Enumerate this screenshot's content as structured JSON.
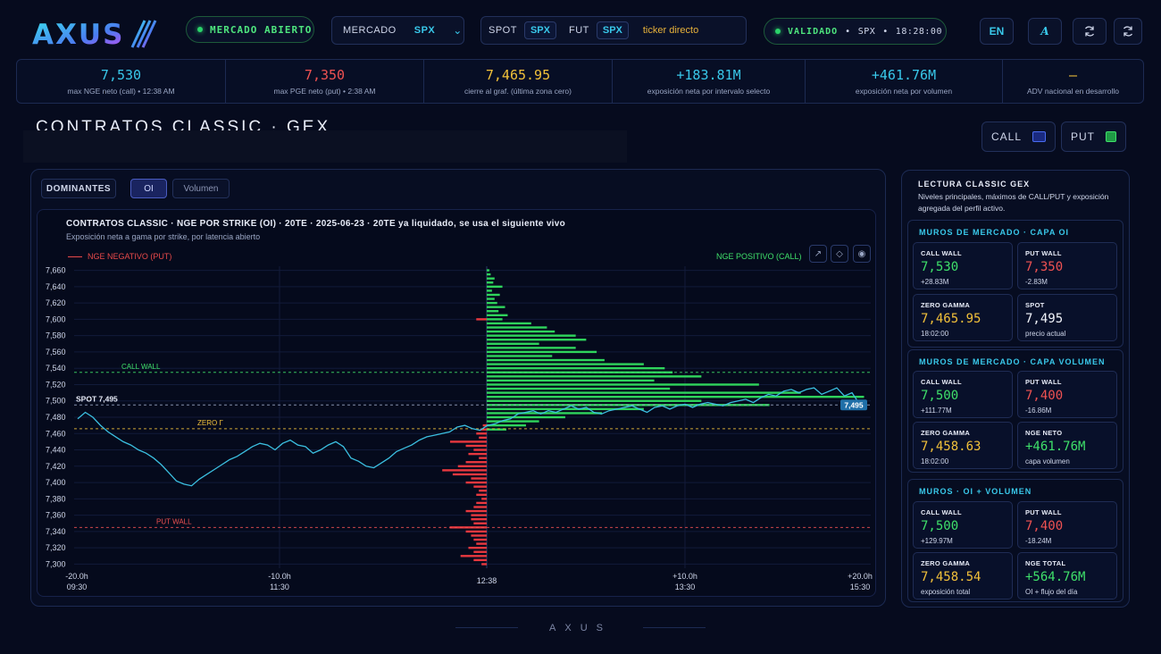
{
  "brand": {
    "logo_text": "AXUS"
  },
  "header": {
    "market_status": "MERCADO ABIERTO",
    "market_label": "MERCADO",
    "market_value": "SPX",
    "spot_label": "SPOT",
    "spot_tag": "SPX",
    "fut_label": "FUT",
    "fut_tag": "SPX",
    "ticker_placeholder": "ticker directo",
    "validated": "VALIDADO",
    "validated_symbol": "SPX",
    "validated_time": "18:28:00",
    "lang": "EN",
    "font_btn": "A"
  },
  "stats": [
    {
      "value": "7,530",
      "label": "max NGE neto (call) • 12:38 AM",
      "color": "#39c8ea"
    },
    {
      "value": "7,350",
      "label": "max PGE neto (put) • 2:38 AM",
      "color": "#f05252"
    },
    {
      "value": "7,465.95",
      "label": "cierre al graf. (última zona cero)",
      "color": "#f2c13a"
    },
    {
      "value": "+183.81M",
      "label": "exposición neta por intervalo selecto",
      "color": "#39c8ea"
    },
    {
      "value": "+461.76M",
      "label": "exposición neta por volumen",
      "color": "#39c8ea"
    },
    {
      "value": "—",
      "label": "ADV nacional en desarrollo",
      "color": "#f2c13a"
    }
  ],
  "section": {
    "title": "CONTRATOS CLASSIC · GEX",
    "call": "CALL",
    "put": "PUT"
  },
  "controls": {
    "dominantes": "DOMINANTES",
    "oi": "OI",
    "volumen": "Volumen"
  },
  "chart_meta": {
    "title": "CONTRATOS CLASSIC · NGE POR STRIKE (OI) · 20TE · 2025-06-23 · 20TE ya liquidado, se usa el siguiente vivo",
    "subtitle": "Exposición neta a gama por strike, por latencia abierto",
    "legend_neg": "NGE NEGATIVO (PUT)",
    "legend_pos": "NGE POSITIVO (CALL)"
  },
  "chart_data": {
    "type": "bar",
    "title": "CONTRATOS CLASSIC · NGE POR STRIKE (OI) · 20TE · 2025-06-23 · 20TE ya liquidado, se usa el siguiente vivo",
    "y_ticks": [
      "7,660",
      "7,640",
      "7,620",
      "7,600",
      "7,580",
      "7,560",
      "7,540",
      "7,520",
      "7,500",
      "7,480",
      "7,460",
      "7,440",
      "7,420",
      "7,400",
      "7,380",
      "7,360",
      "7,340",
      "7,320",
      "7,300"
    ],
    "ylim": [
      7295,
      7665
    ],
    "x_ticks": [
      {
        "top": "-20.0h",
        "bottom": "09:30"
      },
      {
        "top": "-10.0h",
        "bottom": "11:30"
      },
      {
        "top": "",
        "bottom": "12:38"
      },
      {
        "top": "+10.0h",
        "bottom": "13:30"
      },
      {
        "top": "+20.0h",
        "bottom": "15:30"
      }
    ],
    "levels": [
      {
        "name": "CALL WALL",
        "value": 7535,
        "color": "#3fe06a"
      },
      {
        "name": "SPOT 7,495",
        "value": 7495,
        "color": "#9aa6c4"
      },
      {
        "name": "ZERO Γ",
        "value": 7465.95,
        "color": "#f2c13a"
      },
      {
        "name": "PUT WALL",
        "value": 7345,
        "color": "#f05252"
      }
    ],
    "price_tag": "7,495",
    "call_strikes": [
      7660,
      7655,
      7650,
      7645,
      7640,
      7635,
      7630,
      7625,
      7620,
      7615,
      7610,
      7605,
      7600,
      7595,
      7590,
      7585,
      7580,
      7575,
      7570,
      7565,
      7560,
      7555,
      7550,
      7545,
      7540,
      7535,
      7530,
      7525,
      7520,
      7515,
      7510,
      7505,
      7500,
      7495,
      7490,
      7485,
      7480,
      7475,
      7470,
      7465
    ],
    "call_values": [
      0.2,
      0.3,
      0.6,
      0.5,
      1.2,
      0.4,
      1.0,
      0.6,
      0.8,
      1.4,
      0.9,
      1.6,
      1.2,
      3.4,
      4.6,
      5.2,
      6.8,
      7.6,
      4.0,
      6.8,
      8.4,
      5.0,
      9.0,
      12.0,
      13.6,
      14.2,
      16.4,
      12.8,
      20.8,
      14.0,
      24.0,
      28.83,
      16.4,
      21.6,
      12.0,
      8.8,
      6.0,
      4.0,
      3.0,
      1.5
    ],
    "put_strikes": [
      7470,
      7465,
      7460,
      7455,
      7450,
      7445,
      7440,
      7435,
      7430,
      7425,
      7420,
      7415,
      7410,
      7405,
      7400,
      7395,
      7390,
      7385,
      7380,
      7375,
      7370,
      7365,
      7360,
      7355,
      7350,
      7345,
      7340,
      7335,
      7330,
      7325,
      7320,
      7315,
      7310,
      7305,
      7300,
      7600
    ],
    "put_values": [
      -0.3,
      -0.5,
      -0.8,
      -0.6,
      -2.8,
      -1.6,
      -1.0,
      -1.4,
      -0.6,
      -1.6,
      -2.2,
      -3.4,
      -2.6,
      -1.2,
      -1.6,
      -1.0,
      -0.6,
      -0.8,
      -0.4,
      -0.8,
      -1.0,
      -1.6,
      -1.2,
      -1.2,
      -1.0,
      -2.83,
      -1.6,
      -1.2,
      -1.0,
      -0.8,
      -1.4,
      -1.0,
      -2.0,
      -1.0,
      -0.4,
      -0.8
    ],
    "x_scale_max": 29,
    "price_series": [
      7478,
      7486,
      7480,
      7470,
      7462,
      7456,
      7450,
      7446,
      7440,
      7436,
      7430,
      7422,
      7412,
      7402,
      7398,
      7396,
      7404,
      7410,
      7416,
      7422,
      7428,
      7432,
      7438,
      7444,
      7448,
      7446,
      7440,
      7448,
      7452,
      7446,
      7444,
      7436,
      7440,
      7446,
      7450,
      7444,
      7430,
      7426,
      7420,
      7418,
      7424,
      7430,
      7438,
      7442,
      7446,
      7452,
      7456,
      7458,
      7460,
      7462,
      7468,
      7470,
      7466,
      7464,
      7470,
      7472,
      7476,
      7478,
      7484,
      7486,
      7488,
      7484,
      7488,
      7486,
      7490,
      7494,
      7490,
      7492,
      7486,
      7484,
      7488,
      7490,
      7492,
      7494,
      7490,
      7486,
      7492,
      7494,
      7490,
      7494,
      7496,
      7492,
      7496,
      7498,
      7496,
      7494,
      7498,
      7500,
      7502,
      7498,
      7504,
      7508,
      7506,
      7512,
      7514,
      7510,
      7514,
      7516,
      7508,
      7512,
      7516,
      7506,
      7510,
      7496,
      7495
    ]
  },
  "side": {
    "title": "LECTURA CLASSIC GEX",
    "desc": "Niveles principales, máximos de CALL/PUT y exposición agregada del perfil activo.",
    "groups": [
      {
        "title": "MUROS DE MERCADO · CAPA OI",
        "cards": [
          {
            "label": "CALL WALL",
            "value": "7,530",
            "sub": "+28.83M",
            "tone": "green"
          },
          {
            "label": "PUT WALL",
            "value": "7,350",
            "sub": "-2.83M",
            "tone": "red"
          },
          {
            "label": "ZERO GAMMA",
            "value": "7,465.95",
            "sub": "18:02:00",
            "tone": "yellow"
          },
          {
            "label": "SPOT",
            "value": "7,495",
            "sub": "precio actual",
            "tone": "white"
          }
        ]
      },
      {
        "title": "MUROS DE MERCADO · CAPA VOLUMEN",
        "cards": [
          {
            "label": "CALL WALL",
            "value": "7,500",
            "sub": "+111.77M",
            "tone": "green"
          },
          {
            "label": "PUT WALL",
            "value": "7,400",
            "sub": "-16.86M",
            "tone": "red"
          },
          {
            "label": "ZERO GAMMA",
            "value": "7,458.63",
            "sub": "18:02:00",
            "tone": "yellow"
          },
          {
            "label": "NGE NETO",
            "value": "+461.76M",
            "sub": "capa volumen",
            "tone": "green"
          }
        ]
      },
      {
        "title": "MUROS · OI + VOLUMEN",
        "cards": [
          {
            "label": "CALL WALL",
            "value": "7,500",
            "sub": "+129.97M",
            "tone": "green"
          },
          {
            "label": "PUT WALL",
            "value": "7,400",
            "sub": "-18.24M",
            "tone": "red"
          },
          {
            "label": "ZERO GAMMA",
            "value": "7,458.54",
            "sub": "exposición total",
            "tone": "yellow"
          },
          {
            "label": "NGE TOTAL",
            "value": "+564.76M",
            "sub": "OI + flujo del día",
            "tone": "green"
          }
        ]
      }
    ]
  },
  "footer": {
    "brand": "AXUS"
  }
}
